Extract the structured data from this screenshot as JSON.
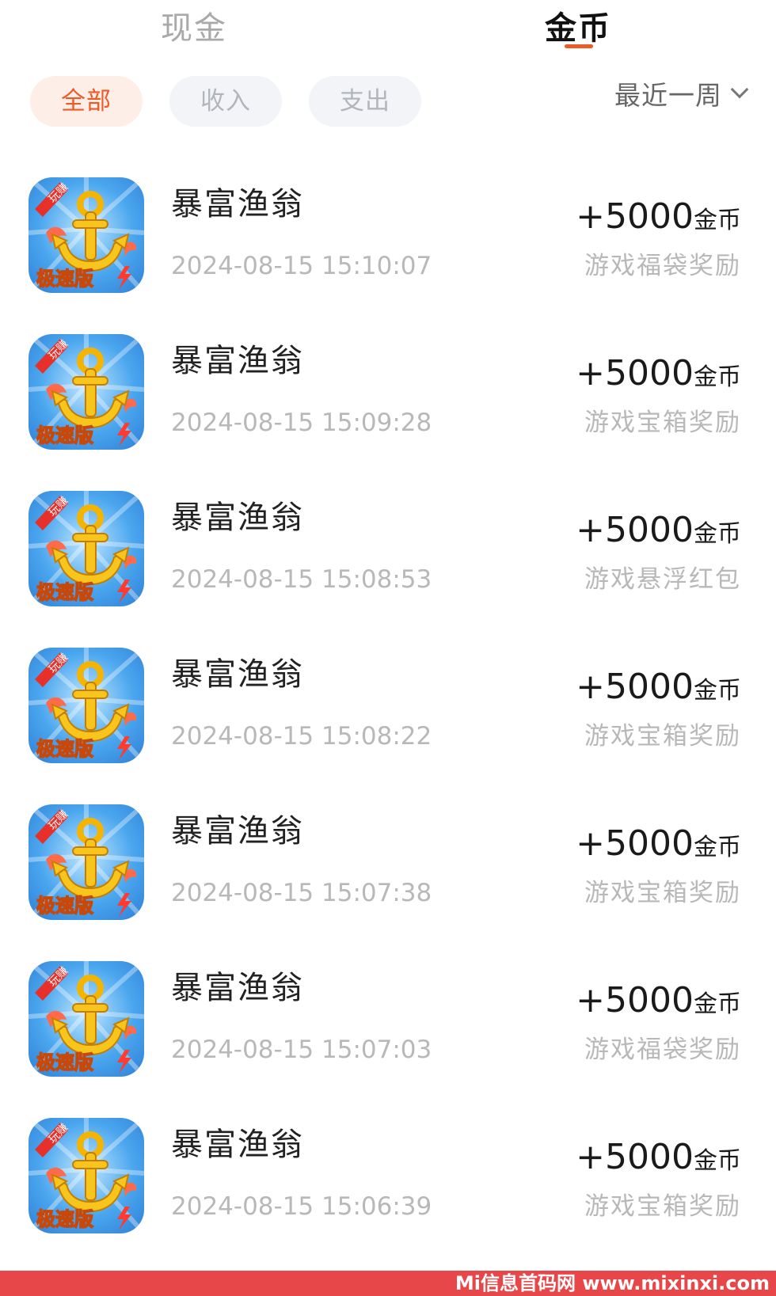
{
  "tabs": {
    "cash_label": "现金",
    "coin_label": "金币",
    "active": "coin"
  },
  "filters": {
    "all_label": "全部",
    "income_label": "收入",
    "expense_label": "支出",
    "active": "all"
  },
  "period": {
    "label": "最近一周",
    "icon": "chevron-down-icon"
  },
  "colors": {
    "accent": "#ee5a26",
    "chip_active_bg": "#fdeee8",
    "chip_bg": "#f3f4f8",
    "muted_text": "#b8b8b8",
    "watermark_bg": "#e8474a"
  },
  "records": [
    {
      "app": "暴富渔翁",
      "time": "2024-08-15 15:10:07",
      "amount": "+5000",
      "unit": "金币",
      "source": "游戏福袋奖励"
    },
    {
      "app": "暴富渔翁",
      "time": "2024-08-15 15:09:28",
      "amount": "+5000",
      "unit": "金币",
      "source": "游戏宝箱奖励"
    },
    {
      "app": "暴富渔翁",
      "time": "2024-08-15 15:08:53",
      "amount": "+5000",
      "unit": "金币",
      "source": "游戏悬浮红包"
    },
    {
      "app": "暴富渔翁",
      "time": "2024-08-15 15:08:22",
      "amount": "+5000",
      "unit": "金币",
      "source": "游戏宝箱奖励"
    },
    {
      "app": "暴富渔翁",
      "time": "2024-08-15 15:07:38",
      "amount": "+5000",
      "unit": "金币",
      "source": "游戏宝箱奖励"
    },
    {
      "app": "暴富渔翁",
      "time": "2024-08-15 15:07:03",
      "amount": "+5000",
      "unit": "金币",
      "source": "游戏福袋奖励"
    },
    {
      "app": "暴富渔翁",
      "time": "2024-08-15 15:06:39",
      "amount": "+5000",
      "unit": "金币",
      "source": "游戏宝箱奖励"
    }
  ],
  "app_icon": {
    "badge_text": "玩赚",
    "edition_text": "极速版"
  },
  "watermark": {
    "text": "Mi信息首码网 www.mixinxi.com"
  }
}
